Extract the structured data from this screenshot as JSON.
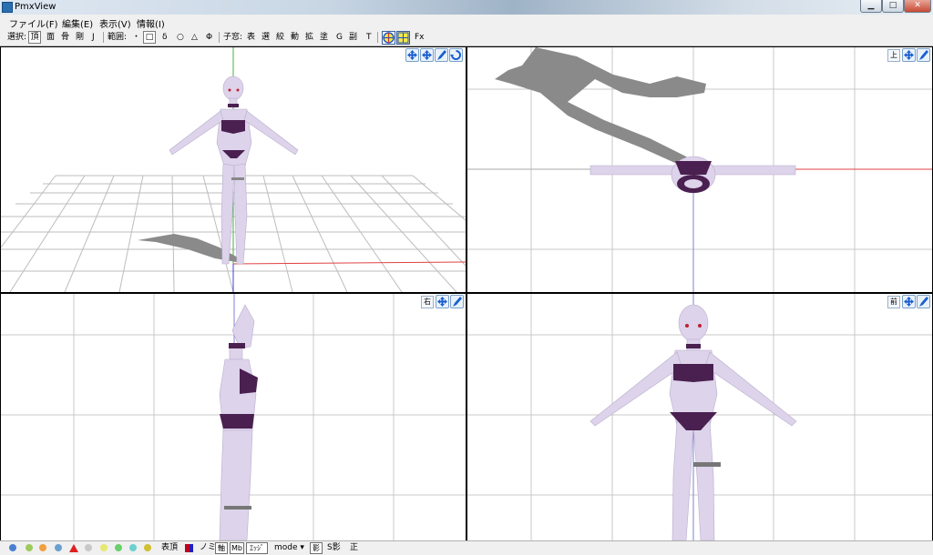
{
  "window": {
    "title": "PmxView",
    "app_icon": "pmx-app-icon",
    "min_label": "▁",
    "max_label": "□",
    "close_label": "✕"
  },
  "menu": [
    {
      "label": "ファイル(F)"
    },
    {
      "label": "編集(E)"
    },
    {
      "label": "表示(V)"
    },
    {
      "label": "情報(I)"
    }
  ],
  "toolbar": {
    "select_label": "選択:",
    "select_modes": [
      "頂",
      "面",
      "骨",
      "剛",
      "J"
    ],
    "active_select": "頂",
    "range_label": "範囲:",
    "range_modes": [
      "・",
      "□",
      "δ",
      "○",
      "△",
      "Φ"
    ],
    "active_range": "□",
    "child_label": "子窓:",
    "child_windows": [
      "表",
      "選",
      "絞",
      "動",
      "拡",
      "塗",
      "G",
      "副",
      "T"
    ],
    "fx_label": "Fx"
  },
  "viewports": {
    "perspective": {
      "buttons": [
        "move-icon",
        "move-icon",
        "rotate-pen-icon",
        "reset-view-icon"
      ]
    },
    "top": {
      "label": "上",
      "buttons": [
        "move-icon",
        "rotate-pen-icon"
      ]
    },
    "right": {
      "label": "右",
      "buttons": [
        "move-icon",
        "rotate-pen-icon"
      ]
    },
    "front": {
      "label": "前",
      "buttons": [
        "move-icon",
        "rotate-pen-icon"
      ]
    }
  },
  "statusbar": {
    "icon_colors": [
      "#4a7fd0",
      "#9ccb5b",
      "#f0a040",
      "#6a9fd0",
      "#e02020",
      "#c8c8c8",
      "#e8e870",
      "#6ad06a",
      "#6ad0d0",
      "#d0c030"
    ],
    "items": [
      "表頂",
      "ノミ"
    ],
    "axis_label": "軸",
    "mb_label": "Mb",
    "edge_label": "ｴｯｼﾞ",
    "mode_label": "mode ▾",
    "shadow_label": "影",
    "sshadow_label": "S影",
    "ortho_label": "正"
  },
  "colors": {
    "skin": "#ddd3ea",
    "bikini": "#4a2050",
    "shadow": "#8a8a8a",
    "grid": "#c8c8c8",
    "axis_x": "#e04040",
    "axis_y": "#40b040",
    "axis_z": "#4040e0"
  }
}
